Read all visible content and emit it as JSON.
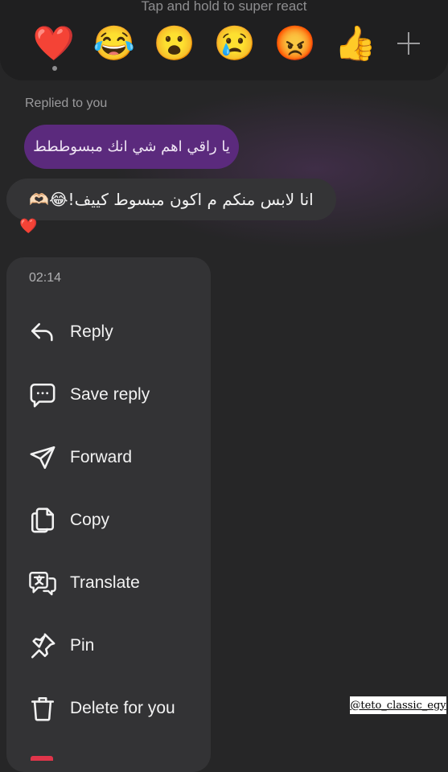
{
  "reactions": {
    "hint": "Tap and hold to super react",
    "emojis": [
      "❤️",
      "😂",
      "😮",
      "😢",
      "😡",
      "👍"
    ],
    "more_icon": "plus-icon"
  },
  "thread": {
    "replied_label": "Replied to you",
    "quoted_message": "يا راقي اهم شي انك مبسوططط",
    "message": "انا لابس منكم م اكون مبسوط كييف!😂🫶🏻",
    "reaction": "❤️"
  },
  "menu": {
    "time": "02:14",
    "items": [
      {
        "label": "Reply",
        "icon": "reply-icon"
      },
      {
        "label": "Save reply",
        "icon": "save-reply-icon"
      },
      {
        "label": "Forward",
        "icon": "forward-icon"
      },
      {
        "label": "Copy",
        "icon": "copy-icon"
      },
      {
        "label": "Translate",
        "icon": "translate-icon"
      },
      {
        "label": "Pin",
        "icon": "pin-icon"
      },
      {
        "label": "Delete for you",
        "icon": "trash-icon"
      }
    ]
  },
  "watermark": "@teto_classic_egy",
  "colors": {
    "background": "#262627",
    "menu": "#333335",
    "quoted_bubble": "#5b2a7d",
    "message_bubble": "#343436"
  }
}
